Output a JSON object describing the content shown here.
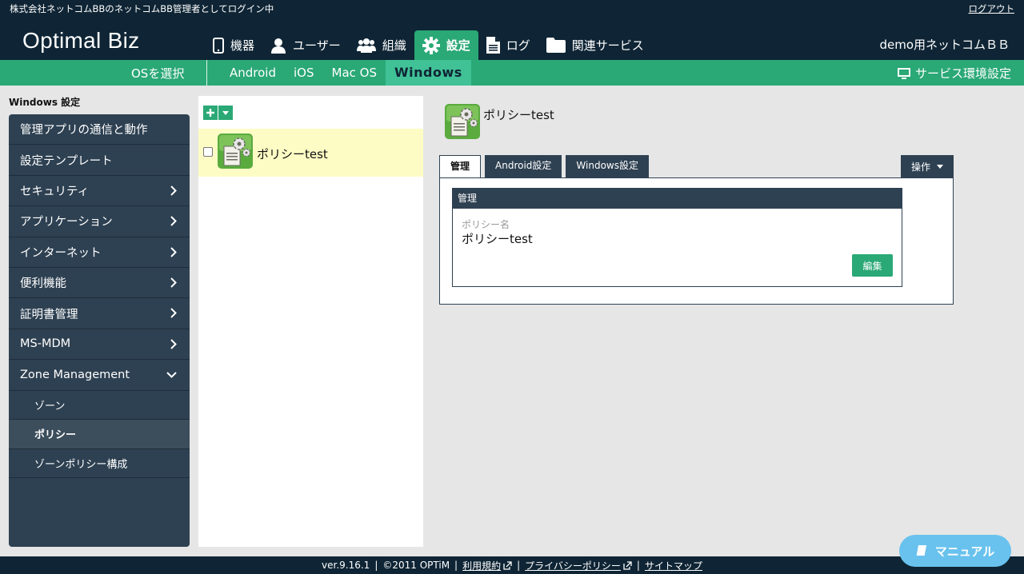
{
  "topbar": {
    "login_message": "株式会社ネットコムBBのネットコムBB管理者としてログイン中",
    "logout": "ログアウト"
  },
  "header": {
    "logo": "Optimal Biz",
    "nav": [
      {
        "label": "機器",
        "icon": "phone-icon"
      },
      {
        "label": "ユーザー",
        "icon": "user-icon"
      },
      {
        "label": "組織",
        "icon": "group-icon"
      },
      {
        "label": "設定",
        "icon": "gear-icon",
        "active": true
      },
      {
        "label": "ログ",
        "icon": "document-icon"
      },
      {
        "label": "関連サービス",
        "icon": "folder-icon"
      }
    ],
    "tenant": "demo用ネットコムＢＢ"
  },
  "subnav": {
    "os_select": "OSを選択",
    "tabs": [
      "Android",
      "iOS",
      "Mac OS",
      "Windows"
    ],
    "active_tab": "Windows",
    "service_env": "サービス環境設定"
  },
  "sidebar": {
    "title": "Windows 設定",
    "items": [
      {
        "label": "管理アプリの通信と動作",
        "chevron": "none"
      },
      {
        "label": "設定テンプレート",
        "chevron": "none"
      },
      {
        "label": "セキュリティ",
        "chevron": "right"
      },
      {
        "label": "アプリケーション",
        "chevron": "right"
      },
      {
        "label": "インターネット",
        "chevron": "right"
      },
      {
        "label": "便利機能",
        "chevron": "right"
      },
      {
        "label": "証明書管理",
        "chevron": "right"
      },
      {
        "label": "MS-MDM",
        "chevron": "right"
      },
      {
        "label": "Zone Management",
        "chevron": "down"
      }
    ],
    "subitems": [
      "ゾーン",
      "ポリシー",
      "ゾーンポリシー構成"
    ],
    "active_subitem": "ポリシー"
  },
  "list": {
    "items": [
      {
        "name": "ポリシーtest",
        "checked": false
      }
    ]
  },
  "detail": {
    "title": "ポリシーtest",
    "tabs": [
      "管理",
      "Android設定",
      "Windows設定"
    ],
    "active_tab": "管理",
    "operations": "操作",
    "card_title": "管理",
    "field_label": "ポリシー名",
    "field_value": "ポリシーtest",
    "edit": "編集"
  },
  "footer": {
    "version": "ver.9.16.1",
    "copyright": "©2011 OPTiM",
    "terms": "利用規約",
    "privacy": "プライバシーポリシー",
    "sitemap": "サイトマップ"
  },
  "manual": "マニュアル",
  "colors": {
    "navy": "#0f2535",
    "green": "#2aa876",
    "sidebar": "#2e4152",
    "manual": "#69c2ee"
  }
}
